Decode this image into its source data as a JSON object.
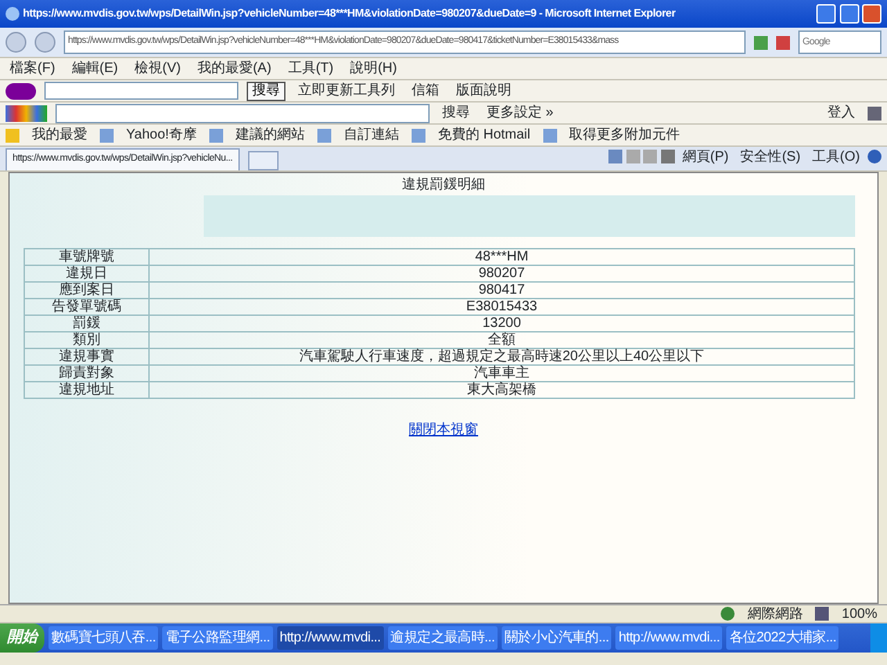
{
  "window": {
    "title": "https://www.mvdis.gov.tw/wps/DetailWin.jsp?vehicleNumber=48***HM&violationDate=980207&dueDate=9 - Microsoft Internet Explorer"
  },
  "address_bar": {
    "url": "https://www.mvdis.gov.tw/wps/DetailWin.jsp?vehicleNumber=48***HM&violationDate=980207&dueDate=980417&ticketNumber=E38015433&mass",
    "search_placeholder": "Google"
  },
  "menu": [
    "檔案(F)",
    "編輯(E)",
    "檢視(V)",
    "我的最愛(A)",
    "工具(T)",
    "說明(H)"
  ],
  "yahoo_toolbar": {
    "search_button": "搜尋",
    "items": [
      "立即更新工具列",
      "信箱",
      "版面說明"
    ]
  },
  "google_toolbar": {
    "search_button": "搜尋",
    "more": "更多設定 »",
    "sign_in": "登入"
  },
  "favorites": [
    "我的最愛",
    "Yahoo!奇摩",
    "建議的網站",
    "自訂連結",
    "免費的 Hotmail",
    "取得更多附加元件"
  ],
  "tabs": [
    {
      "label": "https://www.mvdis.gov.tw/wps/DetailWin.jsp?vehicleNu...",
      "selected": true
    }
  ],
  "command_bar": [
    "網頁(P)",
    "安全性(S)",
    "工具(O)"
  ],
  "page": {
    "title": "違規罰鍰明細",
    "rows": [
      {
        "label": "車號牌號",
        "value": "48***HM"
      },
      {
        "label": "違規日",
        "value": "980207"
      },
      {
        "label": "應到案日",
        "value": "980417"
      },
      {
        "label": "告發單號碼",
        "value": "E38015433"
      },
      {
        "label": "罰鍰",
        "value": "13200"
      },
      {
        "label": "類別",
        "value": "全額"
      },
      {
        "label": "違規事實",
        "value": "汽車駕駛人行車速度，超過規定之最高時速20公里以上40公里以下"
      },
      {
        "label": "歸責對象",
        "value": "汽車車主"
      },
      {
        "label": "違規地址",
        "value": "東大高架橋"
      }
    ],
    "close_link": "關閉本視窗"
  },
  "status_bar": {
    "zone": "網際網路",
    "zoom": "100%"
  },
  "taskbar": {
    "start": "開始",
    "items": [
      {
        "label": "數碼寶七頭八吞...",
        "selected": false
      },
      {
        "label": "電子公路監理網...",
        "selected": false
      },
      {
        "label": "http://www.mvdi...",
        "selected": true
      },
      {
        "label": "逾規定之最高時...",
        "selected": false
      },
      {
        "label": "關於小心汽車的...",
        "selected": false
      },
      {
        "label": "http://www.mvdi...",
        "selected": false
      },
      {
        "label": "各位2022大埔家...",
        "selected": false
      }
    ]
  }
}
